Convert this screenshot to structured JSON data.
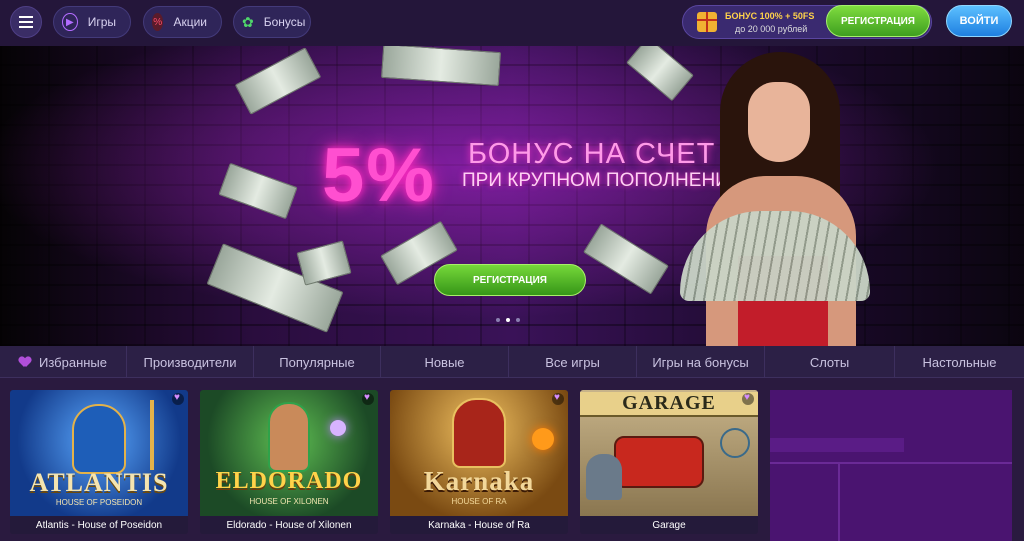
{
  "header": {
    "menu_icon": "hamburger-icon",
    "nav": [
      {
        "label": "Игры",
        "icon": "play-icon",
        "color": "#b36cff"
      },
      {
        "label": "Акции",
        "icon": "percent-icon",
        "color": "#ff4d6d"
      },
      {
        "label": "Бонусы",
        "icon": "clover-icon",
        "color": "#4fd66b"
      }
    ],
    "promo": {
      "line1": "БОНУС 100% + 50FS",
      "line2": "до 20 000 рублей",
      "icon": "gift-icon"
    },
    "register_label": "РЕГИСТРАЦИЯ",
    "login_label": "ВОЙТИ"
  },
  "banner": {
    "percent": "5%",
    "title": "БОНУС НА СЧЕТ",
    "subtitle": "ПРИ КРУПНОМ ПОПОЛНЕНИИ",
    "cta_label": "РЕГИСТРАЦИЯ",
    "slides_count": 3,
    "active_slide": 2
  },
  "categories": [
    "Избранные",
    "Производители",
    "Популярные",
    "Новые",
    "Все игры",
    "Игры на бонусы",
    "Слоты",
    "Настольные"
  ],
  "games": [
    {
      "name": "Atlantis - House of Poseidon",
      "art_title": "ATLANTIS",
      "art_sub": "HOUSE OF POSEIDON"
    },
    {
      "name": "Eldorado - House of Xilonen",
      "art_title": "ELDORADO",
      "art_sub": "HOUSE OF XILONEN"
    },
    {
      "name": "Karnaka - House of Ra",
      "art_title": "Karnaka",
      "art_sub": "HOUSE OF RA"
    },
    {
      "name": "Garage",
      "art_title": "GARAGE",
      "art_sub": ""
    }
  ],
  "colors": {
    "brand_green": "#5cc22c",
    "brand_blue": "#2f95f0",
    "neon_pink": "#ff4fd0",
    "header_bg": "#24163a"
  }
}
